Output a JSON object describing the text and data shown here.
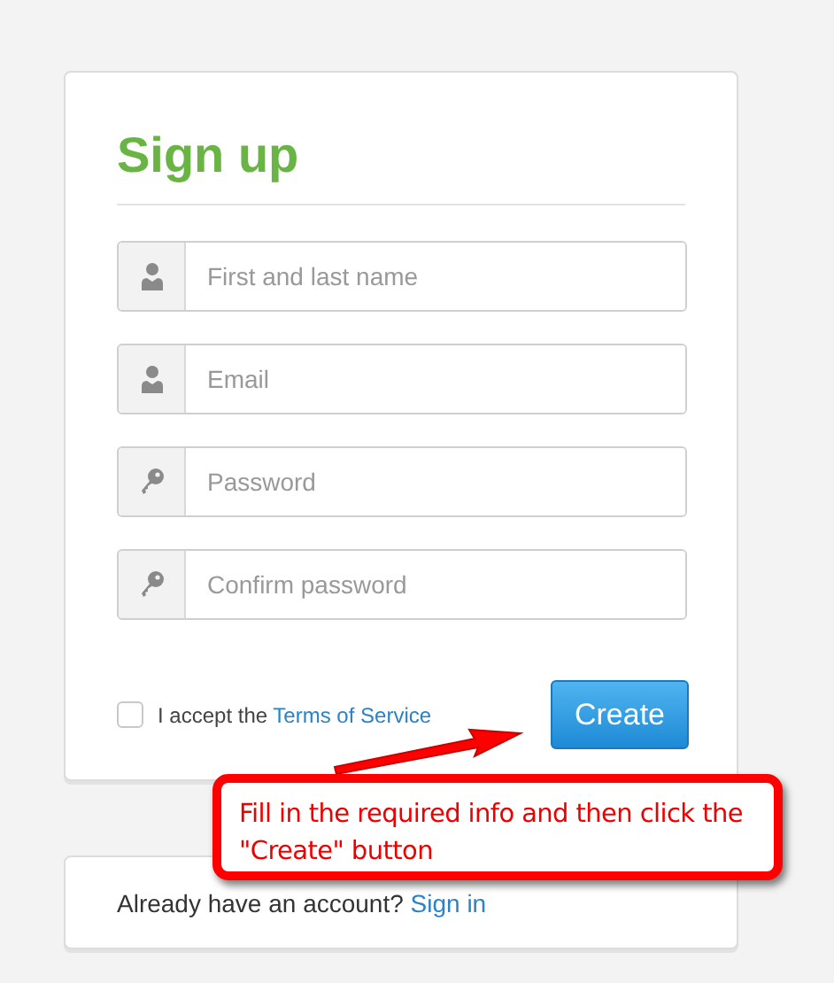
{
  "form": {
    "title": "Sign up",
    "fields": [
      {
        "kind": "person",
        "placeholder": "First and last name"
      },
      {
        "kind": "person",
        "placeholder": "Email"
      },
      {
        "kind": "key",
        "placeholder": "Password"
      },
      {
        "kind": "key",
        "placeholder": "Confirm password"
      }
    ],
    "terms": {
      "checked": false,
      "text": "I accept the",
      "link": "Terms of Service"
    },
    "submit": "Create"
  },
  "signin": {
    "text": "Already have an account?",
    "link": "Sign in"
  },
  "callout": {
    "text": "Fill in the required info and then click the \"Create\" button"
  }
}
